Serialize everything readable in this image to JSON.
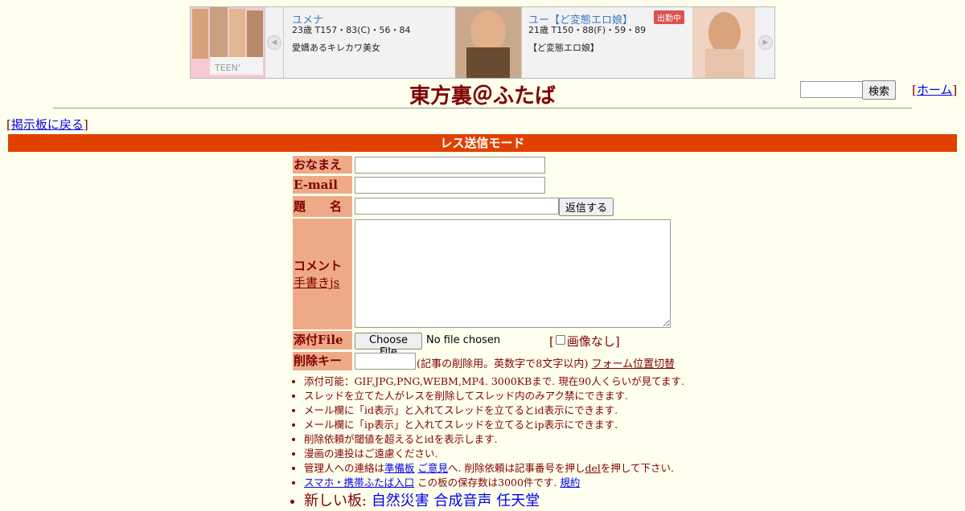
{
  "ad": {
    "left_image_text": "TEEN'",
    "cards": [
      {
        "name": "ユメナ",
        "stats": "23歳 T157・83(C)・56・84",
        "desc": "愛嬌あるキレカワ美女",
        "badge": ""
      },
      {
        "name": "ユー【ど変態エロ娘】",
        "stats": "21歳 T150・88(F)・59・89",
        "desc": "【ど変態エロ娘】",
        "badge": "出勤中"
      }
    ],
    "prev_arrow": "◀",
    "next_arrow": "▶"
  },
  "header": {
    "title": "東方裏＠ふたば",
    "search_button": "検索",
    "home_link": "ホーム",
    "back_link": "掲示板に戻る"
  },
  "mode_bar": "レス送信モード",
  "form": {
    "name_label": "おなまえ",
    "email_label": "E-mail",
    "subject_label": "題　　名",
    "submit_button": "返信する",
    "comment_label": "コメント",
    "handwrite_link": "手書きjs",
    "file_label": "添付File",
    "choose_file_button": "Choose File",
    "file_status": "No file chosen",
    "no_image_label": "画像なし",
    "delkey_label": "削除キー",
    "delkey_note": "(記事の削除用。英数字で8文字以内)",
    "form_toggle_link": "フォーム位置切替"
  },
  "notes": {
    "n1": "添付可能：GIF,JPG,PNG,WEBM,MP4. 3000KBまで. 現在90人くらいが見てます.",
    "n2": "スレッドを立てた人がレスを削除してスレッド内のみアク禁にできます.",
    "n3": "メール欄に「id表示」と入れてスレッドを立てるとid表示にできます.",
    "n4": "メール欄に「ip表示」と入れてスレッドを立てるとip表示にできます.",
    "n5": "削除依頼が閾値を超えるとidを表示します.",
    "n6": "漫画の連投はご遠慮ください.",
    "n7_pre": "管理人への連絡は",
    "n7_link1": "準備板",
    "n7_link2": "ご意見",
    "n7_mid": "へ. 削除依頼は記事番号を押し",
    "n7_link3": "del",
    "n7_post": "を押して下さい.",
    "n8_link": "スマホ・携帯ふたば入口",
    "n8_mid": " この板の保存数は3000件です.",
    "n8_link2": "規約",
    "n9_pre": "新しい板:",
    "new_boards": [
      "自然災害",
      "合成音声",
      "任天堂"
    ]
  }
}
